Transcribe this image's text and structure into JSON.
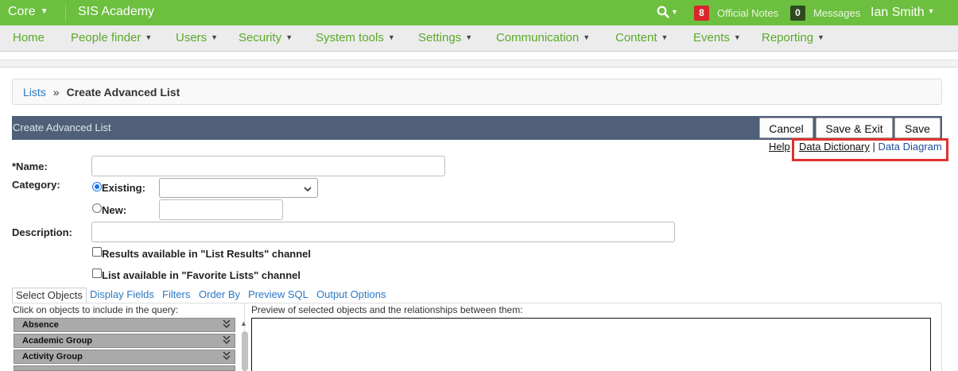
{
  "topbar": {
    "brand": "Core",
    "school": "SIS Academy",
    "notes_count": "8",
    "notes_label": "Official Notes",
    "messages_count": "0",
    "messages_label": "Messages",
    "user_name": "Ian Smith",
    "icons": [
      "caret-down-icon",
      "search-icon"
    ],
    "color": "#6cbf3f"
  },
  "nav": {
    "items": [
      "Home",
      "People finder",
      "Users",
      "Security",
      "System tools",
      "Settings",
      "Communication",
      "Content",
      "Events",
      "Reporting"
    ],
    "link_color": "#5aaa2a"
  },
  "breadcrumb": {
    "link": "Lists",
    "separator": "»",
    "current": "Create Advanced List"
  },
  "panel": {
    "title": "Create Advanced List",
    "cancel_label": "Cancel",
    "save_exit_label": "Save & Exit",
    "save_label": "Save",
    "color": "#4f6078"
  },
  "help_links": {
    "help": "Help",
    "data_dictionary": "Data Dictionary",
    "separator": "|",
    "data_diagram": "Data Diagram",
    "highlight_color": "#e0302e"
  },
  "form": {
    "name_label": "*Name:",
    "name_value": "",
    "category_label": "Category:",
    "existing_label": "Existing:",
    "existing_selected": "",
    "new_label": "New:",
    "new_value": "",
    "description_label": "Description:",
    "description_value": "",
    "check_results_label": "Results available in \"List Results\" channel",
    "check_favorites_label": "List available in \"Favorite Lists\" channel"
  },
  "tabs": {
    "items": [
      "Select Objects",
      "Display Fields",
      "Filters",
      "Order By",
      "Preview SQL",
      "Output Options"
    ],
    "active": "Select Objects"
  },
  "objects": {
    "hint": "Click on objects to include in the query:",
    "items": [
      "Absence",
      "Academic Group",
      "Activity Group"
    ]
  },
  "preview": {
    "hint": "Preview of selected objects and the relationships between them:"
  }
}
